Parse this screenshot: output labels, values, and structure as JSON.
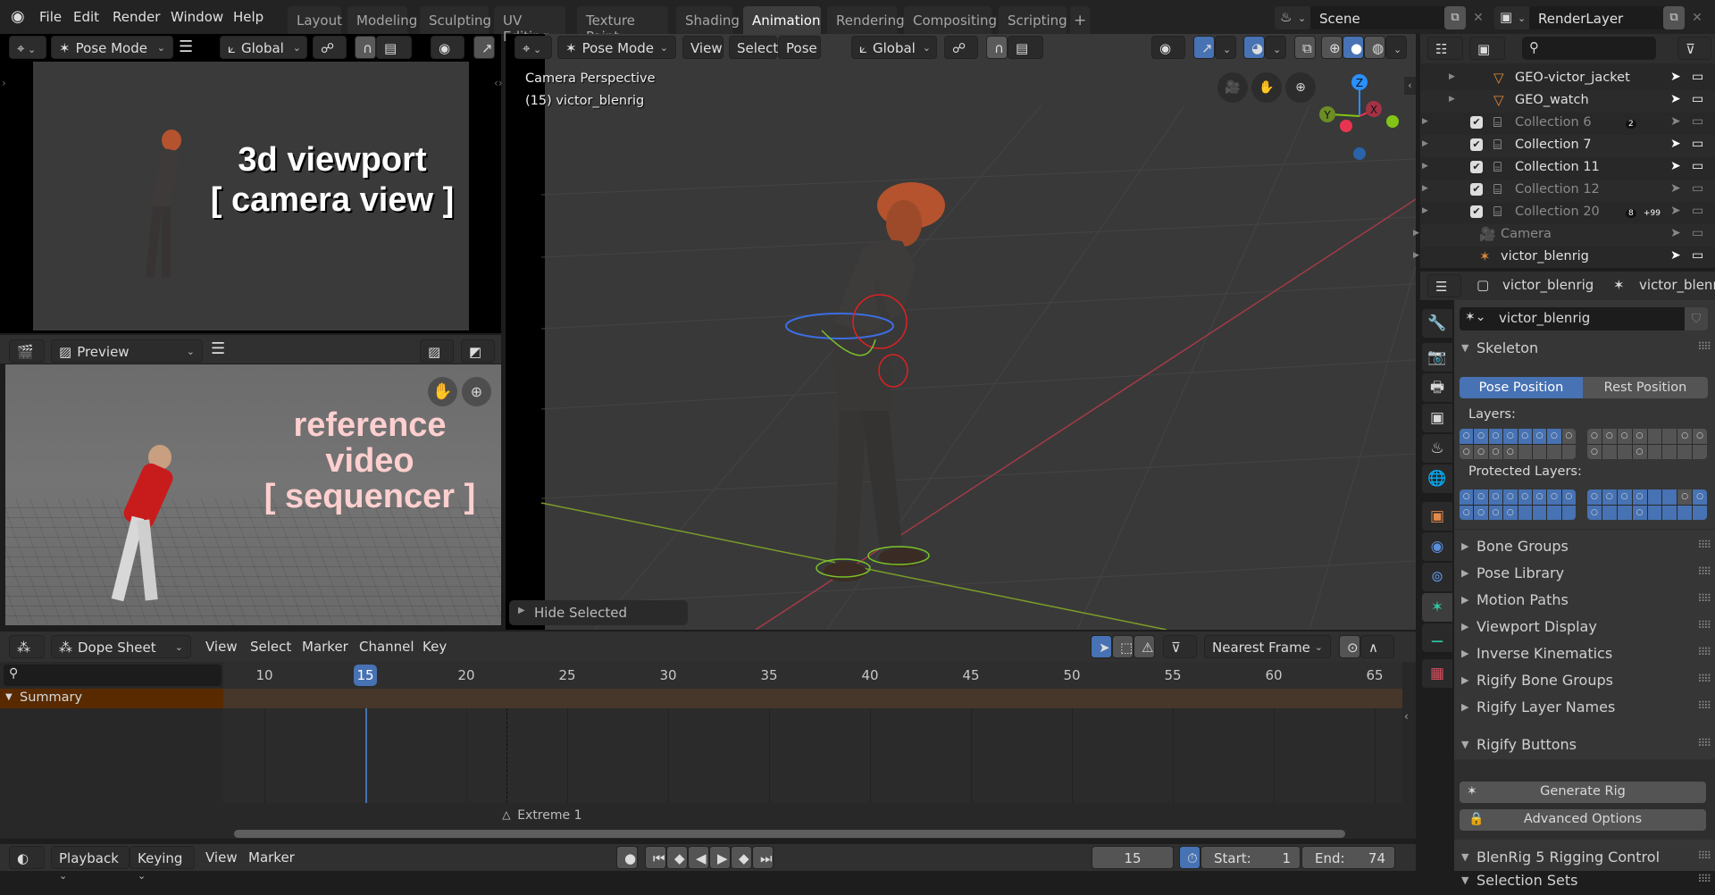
{
  "topbar": {
    "menus": [
      "File",
      "Edit",
      "Render",
      "Window",
      "Help"
    ],
    "workspaces": [
      "Layout",
      "Modeling",
      "Sculpting",
      "UV Editing",
      "Texture Paint",
      "Shading",
      "Animation",
      "Rendering",
      "Compositing",
      "Scripting"
    ],
    "active_workspace": "Animation",
    "add_workspace": "+",
    "scene": "Scene",
    "view_layer": "RenderLayer"
  },
  "camera_viewport": {
    "mode": "Pose Mode",
    "orientation": "Global",
    "overlay_title_line1": "3d viewport",
    "overlay_title_line2": "[ camera view ]"
  },
  "sequencer": {
    "view_type": "Preview",
    "overlay_line1": "reference",
    "overlay_line2": "video",
    "overlay_line3": "[ sequencer ]"
  },
  "main_viewport": {
    "mode": "Pose Mode",
    "menus": [
      "View",
      "Select",
      "Pose"
    ],
    "orientation": "Global",
    "info_line1": "Camera Perspective",
    "info_line2": "(15) victor_blenrig",
    "last_operator": "Hide Selected",
    "gizmo_axes": {
      "x": "X",
      "y": "Y",
      "z": "Z"
    },
    "colors": {
      "x": "#e8354f",
      "y": "#83c317",
      "z": "#2a8fff"
    }
  },
  "outliner": {
    "search_placeholder": "",
    "rows": [
      {
        "name": "GEO-victor_jacket",
        "dim": false,
        "checkbox": false,
        "icon": "mesh"
      },
      {
        "name": "GEO_watch",
        "dim": false,
        "checkbox": false,
        "icon": "mesh"
      },
      {
        "name": "Collection 6",
        "dim": true,
        "checkbox": true,
        "icon": "collection",
        "badge": "2"
      },
      {
        "name": "Collection 7",
        "dim": false,
        "checkbox": true,
        "icon": "collection"
      },
      {
        "name": "Collection 11",
        "dim": false,
        "checkbox": true,
        "icon": "collection"
      },
      {
        "name": "Collection 12",
        "dim": true,
        "checkbox": true,
        "icon": "collection"
      },
      {
        "name": "Collection 20",
        "dim": true,
        "checkbox": true,
        "icon": "collection",
        "badge": "8",
        "badge2": "+99"
      },
      {
        "name": "Camera",
        "dim": true,
        "checkbox": false,
        "icon": "camera"
      },
      {
        "name": "victor_blenrig",
        "dim": false,
        "checkbox": false,
        "icon": "armature"
      }
    ]
  },
  "properties": {
    "breadcrumb_object": "victor_blenrig",
    "breadcrumb_data": "victor_blenrig",
    "datablock": "victor_blenrig",
    "skeleton_label": "Skeleton",
    "pose_position": "Pose Position",
    "rest_position": "Rest Position",
    "layers_label": "Layers:",
    "protected_layers_label": "Protected Layers:",
    "panels_closed": [
      "Bone Groups",
      "Pose Library",
      "Motion Paths",
      "Viewport Display",
      "Inverse Kinematics",
      "Rigify Bone Groups",
      "Rigify Layer Names"
    ],
    "rigify_buttons": "Rigify Buttons",
    "generate_rig": "Generate Rig",
    "advanced_options": "Advanced Options",
    "blenrig_panel": "BlenRig 5 Rigging Control",
    "selection_sets": "Selection Sets"
  },
  "dopesheet": {
    "editor": "Dope Sheet",
    "menus": [
      "View",
      "Select",
      "Marker",
      "Channel",
      "Key"
    ],
    "snapping": "Nearest Frame",
    "summary": "Summary",
    "frame_ticks": [
      10,
      15,
      20,
      25,
      30,
      35,
      40,
      45,
      50,
      55,
      60,
      65
    ],
    "current_frame": 15,
    "marker_name": "Extreme 1",
    "marker_frame": 22
  },
  "timeline": {
    "menus": [
      "Playback",
      "Keying",
      "View",
      "Marker"
    ],
    "current_frame": "15",
    "start_label": "Start:",
    "start": "1",
    "end_label": "End:",
    "end": "74"
  }
}
